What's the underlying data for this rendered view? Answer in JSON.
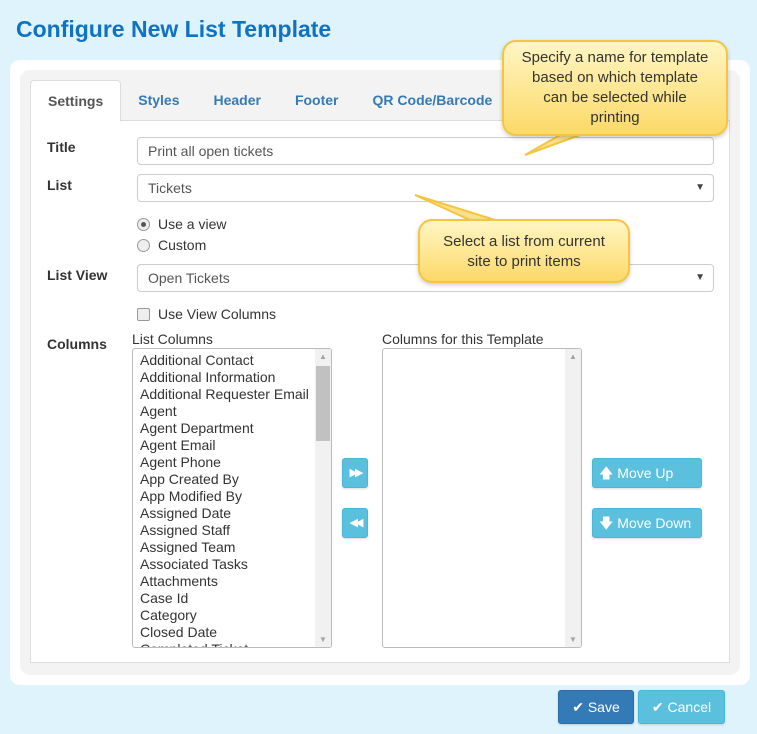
{
  "page_title": "Configure New List Template",
  "tabs": [
    {
      "label": "Settings",
      "active": true
    },
    {
      "label": "Styles"
    },
    {
      "label": "Header"
    },
    {
      "label": "Footer"
    },
    {
      "label": "QR Code/Barcode"
    }
  ],
  "form": {
    "title_label": "Title",
    "title_value": "Print all open tickets",
    "list_label": "List",
    "list_value": "Tickets",
    "radio_use_view": "Use a view",
    "radio_custom": "Custom",
    "radio_selected": "Use a view",
    "list_view_label": "List View",
    "list_view_value": "Open Tickets",
    "use_view_columns": "Use View Columns",
    "use_view_columns_checked": false,
    "columns_label": "Columns",
    "list_columns_label": "List Columns",
    "template_columns_label": "Columns for this Template",
    "list_columns": [
      "Additional Contact",
      "Additional Information",
      "Additional Requester Email",
      "Agent",
      "Agent Department",
      "Agent Email",
      "Agent Phone",
      "App Created By",
      "App Modified By",
      "Assigned Date",
      "Assigned Staff",
      "Assigned Team",
      "Associated Tasks",
      "Attachments",
      "Case Id",
      "Category",
      "Closed Date",
      "Completed Ticket"
    ],
    "template_columns": []
  },
  "buttons": {
    "add": "add-columns",
    "remove": "remove-columns",
    "move_up": "Move Up",
    "move_down": "Move Down",
    "save": "Save",
    "cancel": "Cancel"
  },
  "callouts": {
    "title_tip": "Specify a name for template based on which template can be selected while printing",
    "list_tip": "Select a list from current site to print items"
  },
  "colors": {
    "title": "#0f72c2",
    "tab_link": "#337ab7",
    "info_button": "#5bc0de",
    "primary_button": "#337ab7",
    "background": "#dff3fd",
    "callout": "#fcd968"
  }
}
